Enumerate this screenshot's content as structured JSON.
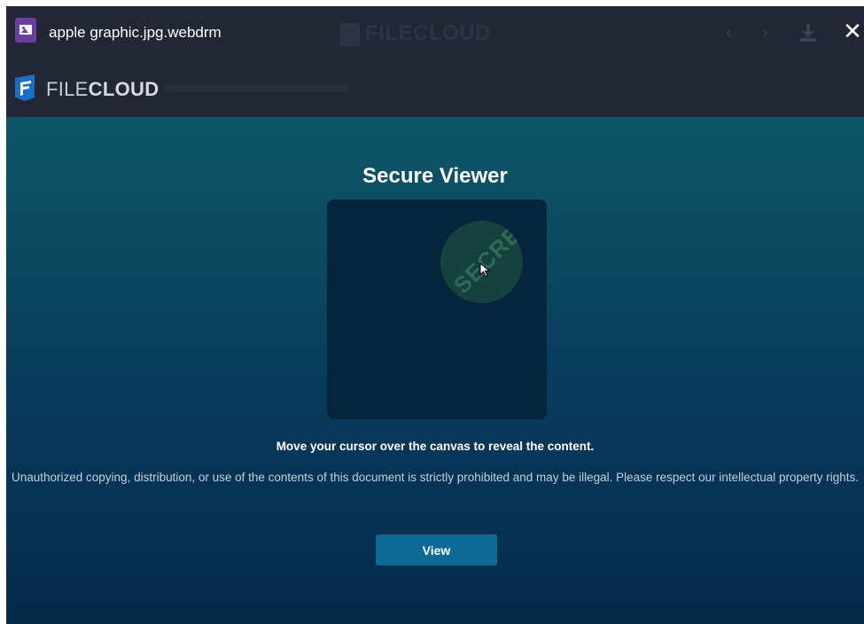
{
  "window": {
    "file_name": "apple graphic.jpg.webdrm",
    "ghost_logo_text": "FILECLOUD",
    "icons": {
      "file": "image-file-icon",
      "prev": "chevron-left-icon",
      "next": "chevron-right-icon",
      "download": "download-icon",
      "close": "close-icon"
    },
    "prev_glyph": "‹",
    "next_glyph": "›",
    "close_glyph": "✕"
  },
  "brand": {
    "name_light": "FILE",
    "name_bold": "CLOUD",
    "logo_icon": "filecloud-logo-icon",
    "colors": {
      "logo": "#1a6fc4",
      "bar": "#232634"
    }
  },
  "viewer": {
    "title": "Secure Viewer",
    "reveal_text": "SECRET",
    "instruction": "Move your cursor over the canvas to reveal the content.",
    "notice": "Unauthorized copying, distribution, or use of the contents of this document is strictly prohibited and may be illegal. Please respect our intellectual property rights.",
    "view_label": "View",
    "colors": {
      "button": "#0e6a94",
      "background_top": "#0e5669",
      "background_bottom": "#052a4a"
    }
  }
}
